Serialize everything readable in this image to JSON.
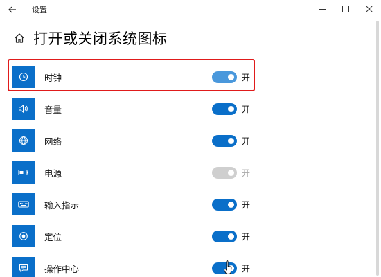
{
  "titlebar": {
    "app_title": "设置",
    "back_icon": "back-arrow-icon",
    "minimize_icon": "minimize-icon",
    "maximize_icon": "maximize-icon",
    "close_icon": "close-icon"
  },
  "page": {
    "title": "打开或关闭系统图标",
    "home_icon": "home-icon"
  },
  "items": [
    {
      "label": "时钟",
      "icon": "clock-icon",
      "state": "开",
      "on": true,
      "disabled": false,
      "highlighted": true
    },
    {
      "label": "音量",
      "icon": "volume-icon",
      "state": "开",
      "on": true,
      "disabled": false,
      "highlighted": false
    },
    {
      "label": "网络",
      "icon": "network-globe-icon",
      "state": "开",
      "on": true,
      "disabled": false,
      "highlighted": false
    },
    {
      "label": "电源",
      "icon": "battery-icon",
      "state": "开",
      "on": true,
      "disabled": true,
      "highlighted": false
    },
    {
      "label": "输入指示",
      "icon": "keyboard-icon",
      "state": "开",
      "on": true,
      "disabled": false,
      "highlighted": false
    },
    {
      "label": "定位",
      "icon": "location-icon",
      "state": "开",
      "on": true,
      "disabled": false,
      "highlighted": false
    },
    {
      "label": "操作中心",
      "icon": "action-center-icon",
      "state": "开",
      "on": true,
      "disabled": false,
      "highlighted": false
    }
  ],
  "colors": {
    "accent": "#0a6fc9",
    "highlight_border": "#e01b1b",
    "toggle_disabled": "#cfcfcf"
  }
}
